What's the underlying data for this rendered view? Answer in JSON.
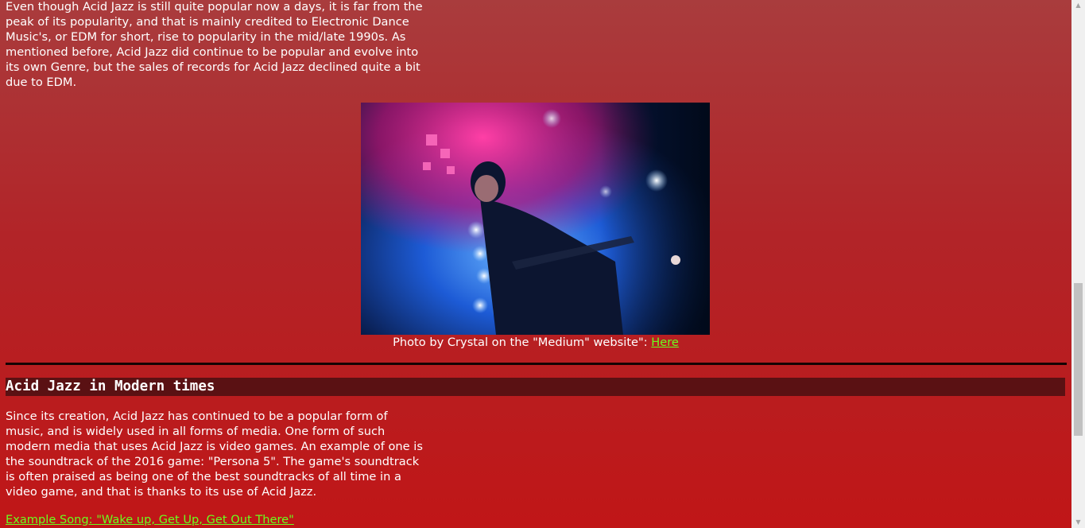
{
  "intro": {
    "paragraph": "Even though Acid Jazz is still quite popular now a days, it is far from the peak of its popularity, and that is mainly credited to Electronic Dance Music's, or EDM for short, rise to popularity in the mid/late 1990s. As mentioned before, Acid Jazz did continue to be popular and evolve into its own Genre, but the sales of records for Acid Jazz declined quite a bit due to EDM."
  },
  "figure": {
    "caption_text": "Photo by Crystal on the \"Medium\" website\": ",
    "caption_link": "Here"
  },
  "section": {
    "title": "Acid Jazz in Modern times",
    "paragraph": "Since its creation, Acid Jazz has continued to be a popular form of music, and is widely used in all forms of media. One form of such modern media that uses Acid Jazz is video games. An example of one is the soundtrack of the 2016 game: \"Persona 5\". The game's soundtrack is often praised as being one of the best soundtracks of all time in a video game, and that is thanks to its use of Acid Jazz.",
    "example_link": "Example Song: \"Wake up, Get Up, Get Out There\""
  },
  "colors": {
    "background_top": "#a93c3d",
    "background_bottom": "#c01617",
    "link": "#69ff1e",
    "heading_bar": "#5a1113"
  }
}
